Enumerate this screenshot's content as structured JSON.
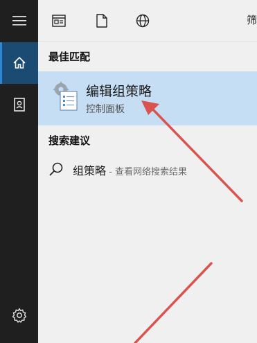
{
  "rail": {
    "items": [
      {
        "name": "menu",
        "icon": "hamburger-icon"
      },
      {
        "name": "home",
        "icon": "home-icon",
        "active": true
      },
      {
        "name": "notebook",
        "icon": "notebook-icon"
      },
      {
        "name": "settings",
        "icon": "gear-icon"
      }
    ]
  },
  "topbar": {
    "filters": [
      "apps-icon",
      "document-icon",
      "globe-icon"
    ],
    "filter_label": "筛"
  },
  "best_match": {
    "header": "最佳匹配",
    "title": "编辑组策略",
    "subtitle": "控制面板",
    "icon": "group-policy-icon"
  },
  "suggestions": {
    "header": "搜索建议",
    "items": [
      {
        "query": "组策略",
        "desc": " - 查看网络搜索结果",
        "icon": "search-icon"
      }
    ]
  },
  "colors": {
    "rail_bg": "#1f1f1f",
    "rail_active": "#1b4a72",
    "highlight": "#c6def4",
    "annotation": "#d9534f"
  }
}
